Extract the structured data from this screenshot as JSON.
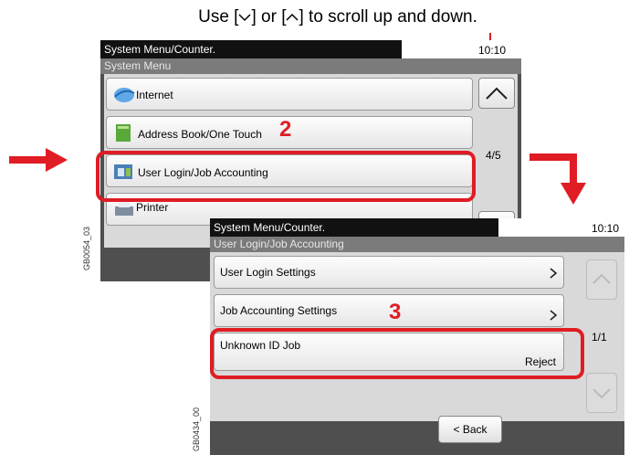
{
  "caption": {
    "before": "Use [",
    "mid": "] or [",
    "after": "] to scroll up and down."
  },
  "panel1": {
    "header": "System Menu/Counter.",
    "clock": "10:10",
    "subheader": "System Menu",
    "items": [
      {
        "label": "Internet"
      },
      {
        "label": "Address Book/One Touch"
      },
      {
        "label": "User Login/Job Accounting"
      },
      {
        "label": "Printer"
      }
    ],
    "page": "4/5",
    "step": "2",
    "code": "GB0054_03"
  },
  "panel2": {
    "header": "System Menu/Counter.",
    "clock": "10:10",
    "subheader": "User Login/Job Accounting",
    "items": [
      {
        "label": "User Login Settings"
      },
      {
        "label": "Job Accounting Settings"
      },
      {
        "label": "Unknown ID Job",
        "value": "Reject"
      }
    ],
    "page": "1/1",
    "step": "3",
    "back_label": "< Back",
    "code": "GB0434_00"
  },
  "colors": {
    "highlight": "#e01c24",
    "panel_bg": "#4f4f4f",
    "list_bg": "#d9d9d9"
  }
}
